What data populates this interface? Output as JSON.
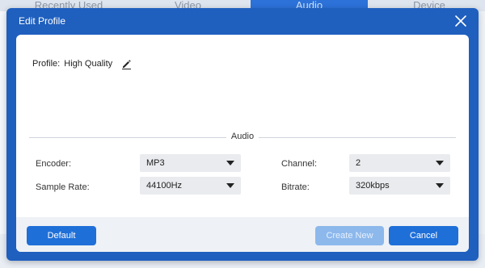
{
  "background": {
    "tabs": [
      {
        "label": "Recently Used",
        "active": false
      },
      {
        "label": "Video",
        "active": false
      },
      {
        "label": "Audio",
        "active": true
      },
      {
        "label": "Device",
        "active": false
      }
    ]
  },
  "dialog": {
    "title": "Edit Profile",
    "close_icon": "close-icon",
    "profile": {
      "label": "Profile:",
      "value": "High Quality",
      "edit_icon": "pencil-icon"
    },
    "section_title": "Audio",
    "fields": {
      "encoder": {
        "label": "Encoder:",
        "value": "MP3"
      },
      "channel": {
        "label": "Channel:",
        "value": "2"
      },
      "sample_rate": {
        "label": "Sample Rate:",
        "value": "44100Hz"
      },
      "bitrate": {
        "label": "Bitrate:",
        "value": "320kbps"
      }
    },
    "buttons": {
      "default": "Default",
      "create_new": "Create New",
      "cancel": "Cancel"
    }
  },
  "colors": {
    "accent": "#1f6fd8",
    "dialog_frame": "#1f5fbe",
    "disabled_button": "#8cb8ec"
  }
}
